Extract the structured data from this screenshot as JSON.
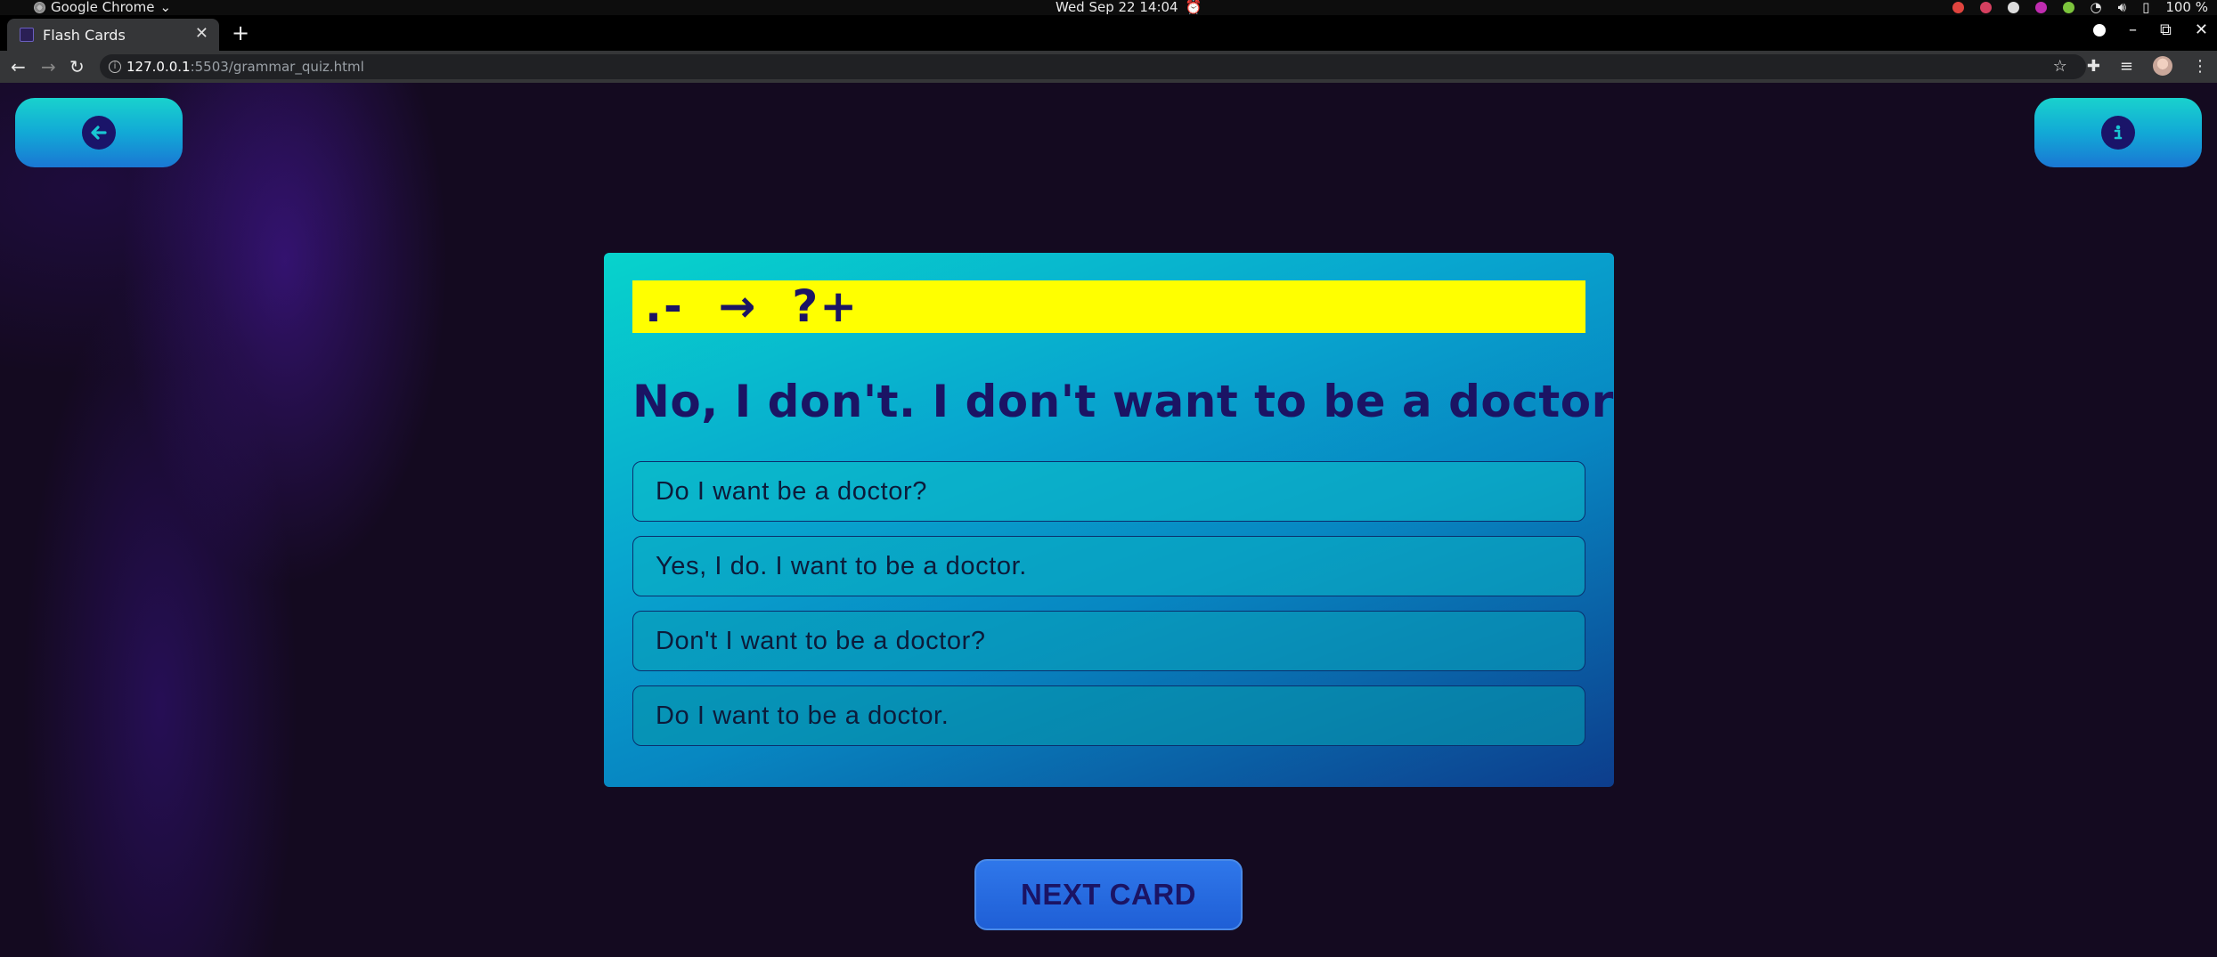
{
  "os": {
    "app_name": "Google Chrome",
    "app_chevron": "⌄",
    "clock": "Wed Sep 22  14:04",
    "battery": "100 %"
  },
  "browser": {
    "tab_title": "Flash Cards",
    "tab_close": "✕",
    "new_tab": "+",
    "url_host": "127.0.0.1",
    "url_path": ":5503/grammar_quiz.html",
    "nav": {
      "back": "←",
      "forward": "→",
      "reload": "↻"
    },
    "window_controls": {
      "minimize": "–",
      "maximize": "⧉",
      "close": "✕"
    }
  },
  "page": {
    "back_icon": "arrow-left",
    "info_icon": "info",
    "card": {
      "formula": ".-  →  ?+",
      "sentence": "No, I don't. I don't want to be a doctor",
      "options": [
        "Do I want be a doctor?",
        "Yes, I do. I want to be a doctor.",
        "Don't I want to be a doctor?",
        "Do I want to be a doctor."
      ]
    },
    "next_button": "NEXT CARD"
  },
  "colors": {
    "formula_bg": "#ffff00",
    "text_dark": "#1b1464",
    "button_gradient_top": "#19d2cd",
    "button_gradient_bottom": "#1a77d4",
    "next_button": "#2f77ea",
    "page_bg": "#140a20"
  }
}
